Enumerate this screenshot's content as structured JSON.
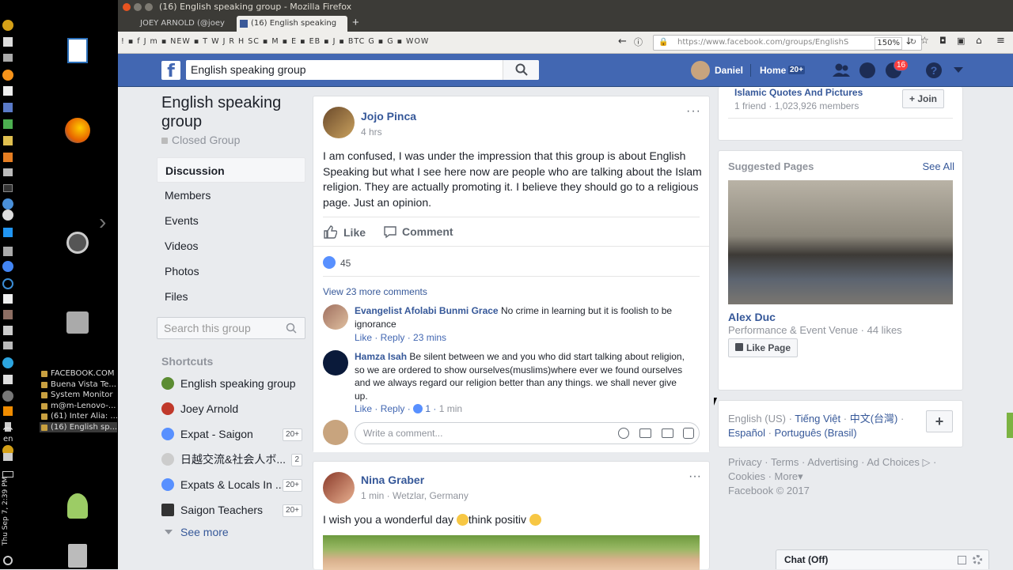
{
  "desktop": {
    "windows": [
      "FACEBOOK.COM",
      "Buena Vista Te...",
      "System Monitor",
      "m@m-Lenovo-...",
      "(61) Inter Alia: ...",
      "(16) English sp..."
    ],
    "lang": "en",
    "clock": "Thu Sep 7, 2:39 PM"
  },
  "browser": {
    "title": "(16) English speaking group - Mozilla Firefox",
    "tabs": [
      "JOEY ARNOLD (@joey",
      "(16) English speaking"
    ],
    "url": "https://www.facebook.com/groups/EnglishS",
    "zoom": "150%",
    "bookmarks": [
      "!",
      "f",
      "J",
      "m",
      "NEW",
      "T",
      "W",
      "J",
      "R",
      "H",
      "SC",
      "M",
      "E",
      "EB",
      "J",
      "BTC",
      "G",
      "G",
      "WOW"
    ]
  },
  "fb": {
    "search_value": "English speaking group",
    "user": "Daniel",
    "home": "Home",
    "home_count": "20+",
    "notif_count": "16"
  },
  "group": {
    "title": "English speaking group",
    "privacy": "Closed Group",
    "nav": [
      "Discussion",
      "Members",
      "Events",
      "Videos",
      "Photos",
      "Files"
    ],
    "search_placeholder": "Search this group",
    "shortcuts_title": "Shortcuts",
    "shortcuts": [
      {
        "label": "English speaking group",
        "count": ""
      },
      {
        "label": "Joey Arnold",
        "count": ""
      },
      {
        "label": "Expat - Saigon",
        "count": "20+"
      },
      {
        "label": "日越交流&社会人ボ...",
        "count": "2"
      },
      {
        "label": "Expats & Locals In ...",
        "count": "20+"
      },
      {
        "label": "Saigon Teachers",
        "count": "20+"
      }
    ],
    "see_more": "See more"
  },
  "post1": {
    "author": "Jojo Pinca",
    "time": "4 hrs",
    "text": "I am confused, I was under the impression that this group is about English Speaking but what I see here now are people who are talking about the Islam religion. They are actually promoting it. I believe they should go to a religious page. Just an opinion.",
    "like": "Like",
    "comment": "Comment",
    "likes": "45",
    "view_more": "View 23 more comments",
    "comments": [
      {
        "author": "Evangelist Afolabi Bunmi Grace",
        "text": "No crime in learning but it is foolish to be ignorance",
        "actions": "Like · Reply · 23 mins"
      },
      {
        "author": "Hamza Isah",
        "text": "Be silent between we and you who did start talking about religion, so we are ordered to show ourselves(muslims)where ever we found ourselves and we always regard our religion better than any things. we shall never give up.",
        "like": "Like",
        "reply": "Reply",
        "reacts": "1",
        "time": "1 min"
      }
    ],
    "write_placeholder": "Write a comment..."
  },
  "post2": {
    "author": "Nina Graber",
    "meta": "1 min · Wetzlar, Germany",
    "text_a": "I wish you a wonderful day",
    "text_b": "think positiv"
  },
  "right": {
    "group_sugg": {
      "name": "Islamic Quotes And Pictures",
      "meta": "1 friend · 1,023,926 members",
      "join": "Join"
    },
    "pages_title": "Suggested Pages",
    "see_all": "See All",
    "page": {
      "name": "Alex Duc",
      "meta": "Performance & Event Venue · 44 likes",
      "btn": "Like Page"
    },
    "langs": {
      "current": "English (US)",
      "others": [
        "Tiếng Việt",
        "中文(台灣)",
        "Español",
        "Português (Brasil)"
      ]
    },
    "footer": {
      "links": [
        "Privacy",
        "Terms",
        "Advertising",
        "Ad Choices",
        "Cookies",
        "More"
      ],
      "copyright": "Facebook © 2017"
    }
  },
  "chat": {
    "label": "Chat (Off)"
  }
}
